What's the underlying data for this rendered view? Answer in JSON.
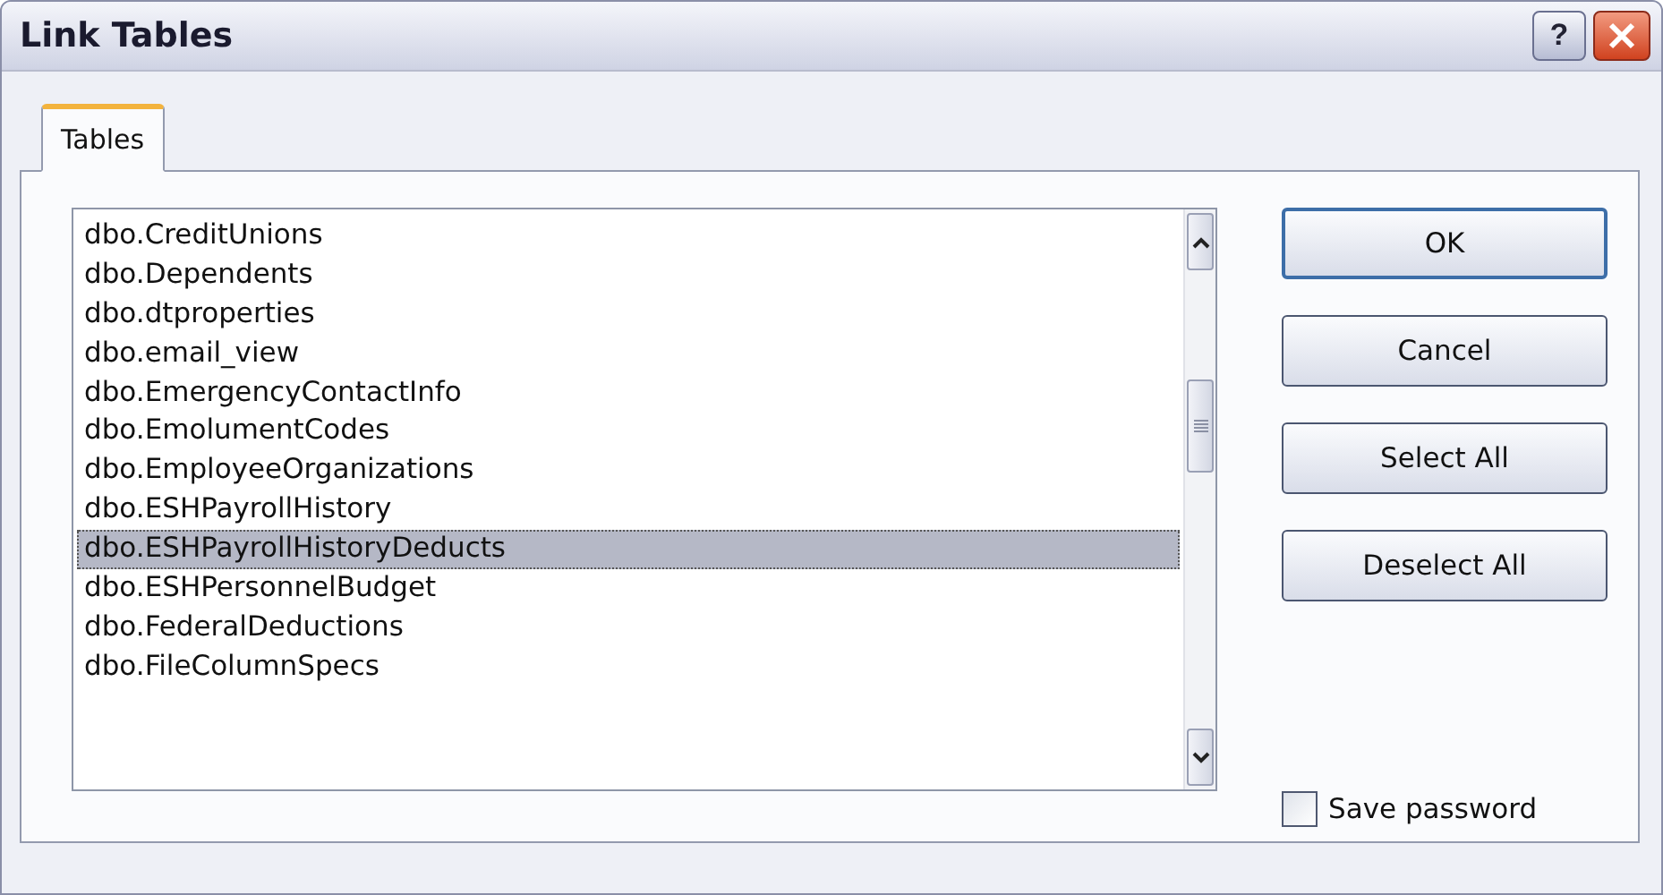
{
  "window": {
    "title": "Link Tables",
    "help": "?"
  },
  "tabs": [
    {
      "label": "Tables",
      "selected": true
    }
  ],
  "list": {
    "items": [
      {
        "label": "dbo.CreditUnions",
        "selected": false
      },
      {
        "label": "dbo.Dependents",
        "selected": false
      },
      {
        "label": "dbo.dtproperties",
        "selected": false
      },
      {
        "label": "dbo.email_view",
        "selected": false
      },
      {
        "label": "dbo.EmergencyContactInfo",
        "selected": false
      },
      {
        "label": "dbo.EmolumentCodes",
        "selected": false
      },
      {
        "label": "dbo.EmployeeOrganizations",
        "selected": false
      },
      {
        "label": "dbo.ESHPayrollHistory",
        "selected": false
      },
      {
        "label": "dbo.ESHPayrollHistoryDeducts",
        "selected": true
      },
      {
        "label": "dbo.ESHPersonnelBudget",
        "selected": false
      },
      {
        "label": "dbo.FederalDeductions",
        "selected": false
      },
      {
        "label": "dbo.FileColumnSpecs",
        "selected": false
      }
    ]
  },
  "buttons": [
    {
      "label": "OK",
      "default": true
    },
    {
      "label": "Cancel",
      "default": false
    },
    {
      "label": "Select All",
      "default": false
    },
    {
      "label": "Deselect All",
      "default": false
    }
  ],
  "save_password": {
    "label": "Save password",
    "checked": false
  }
}
